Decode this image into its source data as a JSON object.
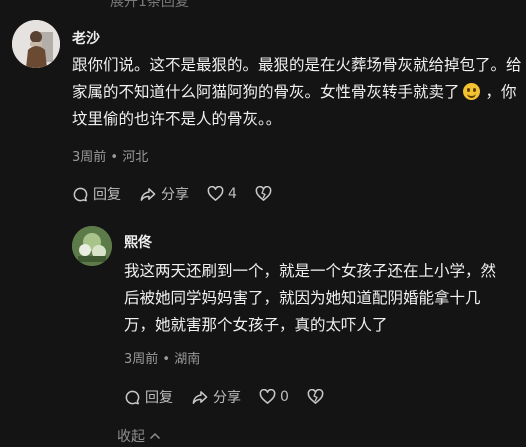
{
  "top_partial": "展开1条回复",
  "comment": {
    "author": "老沙",
    "text_before_emoji": "跟你们说。这不是最狠的。最狠的是在火葬场骨灰就给掉包了。给家属的不知道什么阿猫阿狗的骨灰。女性骨灰转手就卖了",
    "text_after_emoji": "，你坟里偷的也许不是人的骨灰。。",
    "meta": "3周前 • 河北",
    "reply_label": "回复",
    "share_label": "分享",
    "like_count": "4"
  },
  "reply": {
    "author": "熙佟",
    "text": "我这两天还刷到一个，就是一个女孩子还在上小学，然后被她同学妈妈害了，就因为她知道配阴婚能拿十几万，她就害那个女孩子，真的太吓人了",
    "meta": "3周前 • 湖南",
    "reply_label": "回复",
    "share_label": "分享",
    "like_count": "0"
  },
  "collapse_label": "收起",
  "colors": {
    "background": "#141414",
    "muted": "#9a9a9a"
  },
  "icons": [
    "comment-icon",
    "share-icon",
    "heart-icon",
    "broken-heart-icon",
    "chevron-up-icon"
  ]
}
